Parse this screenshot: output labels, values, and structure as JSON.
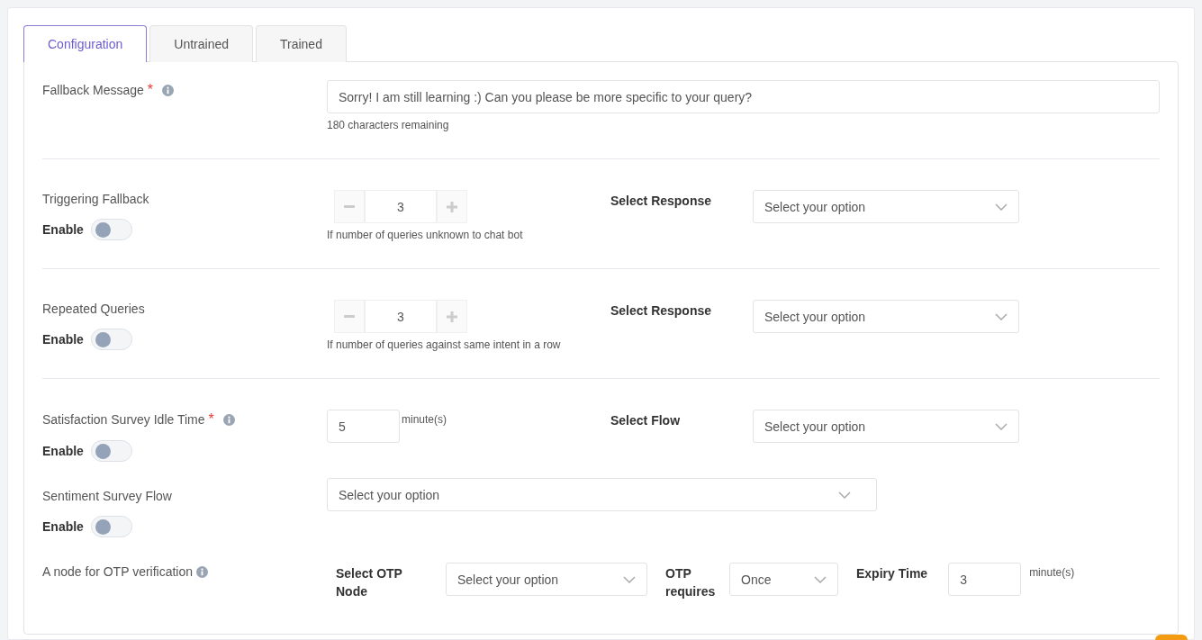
{
  "tabs": [
    {
      "label": "Configuration",
      "selected": true
    },
    {
      "label": "Untrained",
      "selected": false
    },
    {
      "label": "Trained",
      "selected": false
    }
  ],
  "rows": [
    {
      "kind": "message",
      "label": "Fallback Message",
      "required_mark": "*",
      "info": true,
      "value": "Sorry! I am still learning :) Can you please be more specific to your query?",
      "helper": "180 characters remaining",
      "divider": true
    },
    {
      "kind": "stepper",
      "label": "Triggering Fallback",
      "toggle": {
        "label": "Enable",
        "on": false
      },
      "value": "3",
      "helper": "If number of queries unknown to chat bot",
      "side_label": "Select Response",
      "side_placeholder": "Select your option",
      "divider": true
    },
    {
      "kind": "stepper",
      "label": "Repeated Queries",
      "toggle": {
        "label": "Enable",
        "on": false
      },
      "value": "3",
      "helper": "If number of queries against same intent in a row",
      "side_label": "Select Response",
      "side_placeholder": "Select your option",
      "divider": true
    },
    {
      "kind": "duration",
      "label": "Satisfaction Survey Idle Time",
      "required_mark": "*",
      "info": true,
      "toggle": {
        "label": "Enable",
        "on": false
      },
      "value": "5",
      "unit": "minute(s)",
      "side_label": "Select Flow",
      "side_placeholder": "Select your option",
      "divider": false
    },
    {
      "kind": "wide_select",
      "label": "Sentiment Survey Flow",
      "toggle": {
        "label": "Enable",
        "on": false
      },
      "placeholder": "Select your option",
      "divider": false
    },
    {
      "kind": "otp",
      "label": "A node for OTP verification",
      "info": true,
      "node_label": "Select OTP Node",
      "node_placeholder": "Select your option",
      "requires_label": "OTP requires",
      "requires_value": "Once",
      "expiry_label": "Expiry Time",
      "expiry_value": "3",
      "unit": "minute(s)",
      "divider": false
    }
  ]
}
